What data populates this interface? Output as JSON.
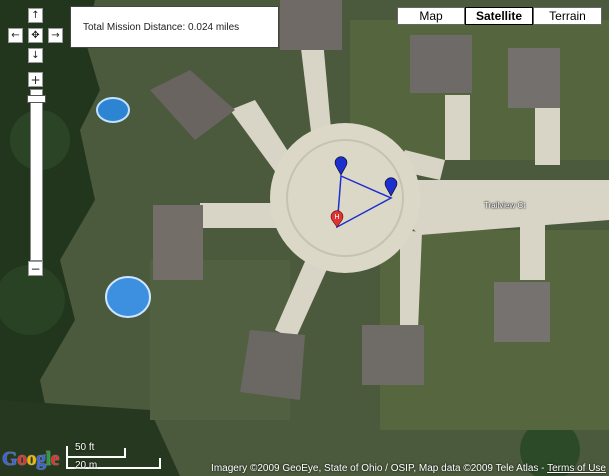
{
  "distance": {
    "text": "Total Mission Distance: 0.024 miles"
  },
  "map_types": [
    {
      "label": "Map",
      "selected": false
    },
    {
      "label": "Satellite",
      "selected": true
    },
    {
      "label": "Terrain",
      "selected": false
    }
  ],
  "nav": {
    "up": "↑",
    "down": "↓",
    "left": "←",
    "right": "→",
    "center": "✥",
    "zoom_in": "+",
    "zoom_out": "−"
  },
  "map": {
    "street_label": "Trailview Ct",
    "markers": [
      {
        "type": "waypoint",
        "color": "#1c2fcf"
      },
      {
        "type": "waypoint",
        "color": "#1c2fcf"
      },
      {
        "type": "home",
        "color": "#d33",
        "glyph": "H"
      }
    ]
  },
  "scale": {
    "feet": "50 ft",
    "meters": "20 m"
  },
  "logo": {
    "letters": [
      "G",
      "o",
      "o",
      "g",
      "l",
      "e"
    ],
    "colors": [
      "#3a62d6",
      "#d33",
      "#f1b600",
      "#3a62d6",
      "#2d9b3a",
      "#d33"
    ]
  },
  "attribution": {
    "text": "Imagery ©2009 GeoEye, State of Ohio / OSIP, Map data ©2009 Tele Atlas - ",
    "terms": "Terms of Use"
  }
}
